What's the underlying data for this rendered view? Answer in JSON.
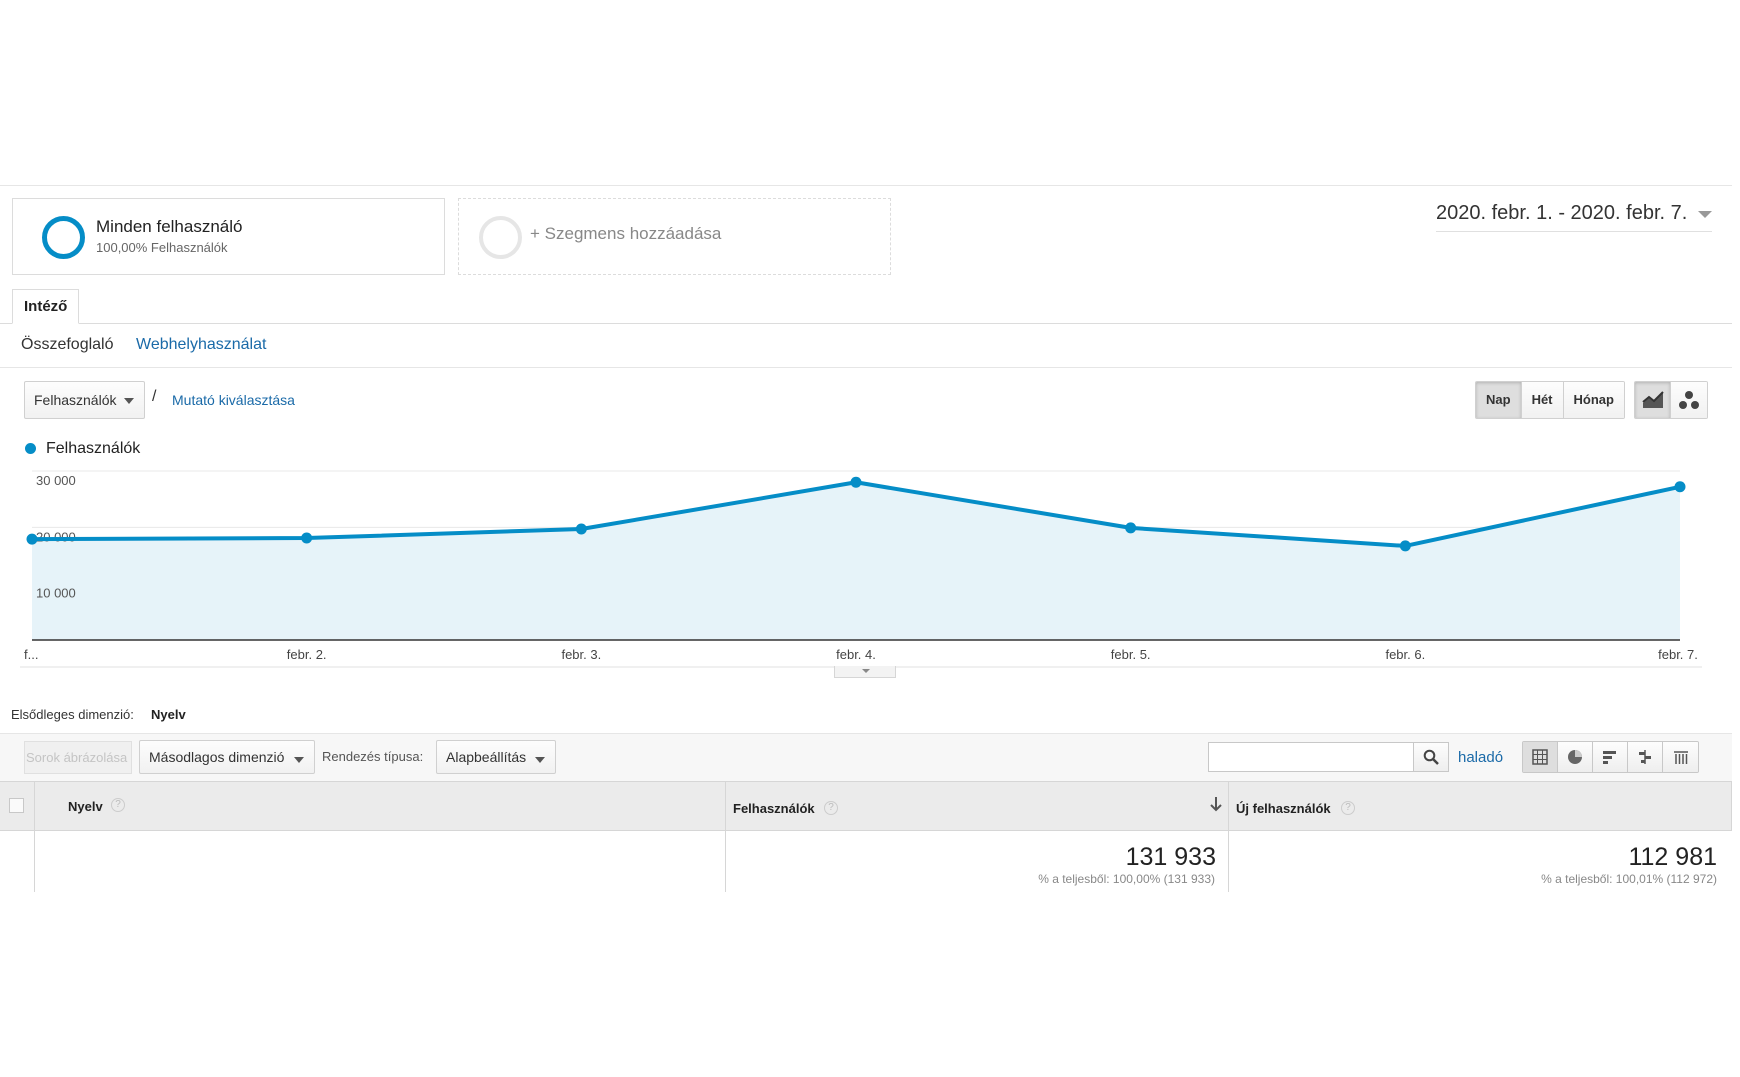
{
  "segments": {
    "active": {
      "title": "Minden felhasználó",
      "subtitle": "100,00% Felhasználók",
      "color": "#058dc7"
    },
    "add_label": "+ Szegmens hozzáadása"
  },
  "date_range": "2020. febr. 1. - 2020. febr. 7.",
  "tabs": {
    "main": "Intéző",
    "sub": [
      "Összefoglaló",
      "Webhelyhasználat"
    ]
  },
  "metric": {
    "selected": "Felhasználók",
    "slash": "/",
    "choose_link": "Mutató kiválasztása"
  },
  "period_buttons": [
    "Nap",
    "Hét",
    "Hónap"
  ],
  "period_selected": "Nap",
  "chart_type_buttons": [
    "line-chart-icon",
    "motion-chart-icon"
  ],
  "legend": "Felhasználók",
  "chart_data": {
    "type": "area",
    "x": [
      "f...",
      "febr. 2.",
      "febr. 3.",
      "febr. 4.",
      "febr. 5.",
      "febr. 6.",
      "febr. 7."
    ],
    "series": [
      {
        "name": "Felhasználók",
        "values": [
          17900,
          18100,
          19700,
          28000,
          19900,
          16700,
          27200
        ]
      }
    ],
    "ylim": [
      0,
      30000
    ],
    "yticks": [
      10000,
      20000,
      30000
    ],
    "ytick_labels": [
      "10 000",
      "20 000",
      "30 000"
    ],
    "color": "#058dc7",
    "fill": "#e6f3f9",
    "grid": true
  },
  "dimension": {
    "label": "Elsődleges dimenzió:",
    "value": "Nyelv"
  },
  "toolbar": {
    "plot_rows": "Sorok ábrázolása",
    "secondary_dimension": "Másodlagos dimenzió",
    "sort_label": "Rendezés típusa:",
    "sort_value": "Alapbeállítás",
    "search_value": "",
    "advanced": "haladó",
    "view_icons": [
      "table-view-icon",
      "pie-view-icon",
      "bar-view-icon",
      "comparison-view-icon",
      "pivot-view-icon"
    ]
  },
  "table": {
    "columns": [
      "Nyelv",
      "Felhasználók",
      "Új felhasználók"
    ],
    "help": "?",
    "totals": [
      {
        "value": "131 933",
        "sub": "% a teljesből: 100,00% (131 933)"
      },
      {
        "value": "112 981",
        "sub": "% a teljesből: 100,01% (112 972)"
      }
    ]
  }
}
